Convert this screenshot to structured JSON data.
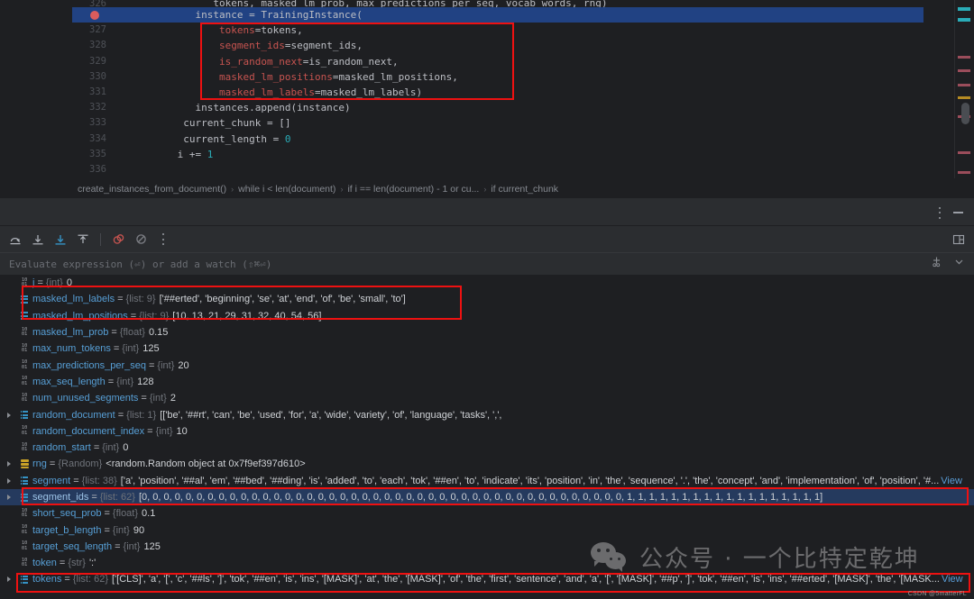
{
  "editor": {
    "lines": [
      {
        "num": "326",
        "indent": 0,
        "partial": true,
        "current": false,
        "breakpoint": false,
        "text": "tokens, masked_lm_prob, max_predictions_per_seq, vocab_words, rng)"
      },
      {
        "num": "",
        "indent": 0,
        "partial": false,
        "current": true,
        "breakpoint": true,
        "text": "instance = TrainingInstance("
      },
      {
        "num": "327",
        "indent": 0,
        "partial": false,
        "current": false,
        "breakpoint": false,
        "param": "tokens",
        "text": "=tokens,"
      },
      {
        "num": "328",
        "indent": 0,
        "partial": false,
        "current": false,
        "breakpoint": false,
        "param": "segment_ids",
        "text": "=segment_ids,"
      },
      {
        "num": "329",
        "indent": 0,
        "partial": false,
        "current": false,
        "breakpoint": false,
        "param": "is_random_next",
        "text": "=is_random_next,"
      },
      {
        "num": "330",
        "indent": 0,
        "partial": false,
        "current": false,
        "breakpoint": false,
        "param": "masked_lm_positions",
        "text": "=masked_lm_positions,"
      },
      {
        "num": "331",
        "indent": 0,
        "partial": false,
        "current": false,
        "breakpoint": false,
        "param": "masked_lm_labels",
        "text": "=masked_lm_labels)"
      },
      {
        "num": "332",
        "indent": 0,
        "partial": false,
        "current": false,
        "breakpoint": false,
        "text": "instances.append(instance)"
      },
      {
        "num": "333",
        "indent": 0,
        "partial": false,
        "current": false,
        "breakpoint": false,
        "text": "current_chunk = []"
      },
      {
        "num": "334",
        "indent": 0,
        "partial": false,
        "current": false,
        "breakpoint": false,
        "text": "current_length = ",
        "num_lit": "0"
      },
      {
        "num": "335",
        "indent": 0,
        "partial": false,
        "current": false,
        "breakpoint": false,
        "text": "i += ",
        "num_lit": "1"
      },
      {
        "num": "336",
        "indent": 0,
        "partial": false,
        "current": false,
        "breakpoint": false,
        "text": ""
      }
    ],
    "breadcrumb": [
      "create_instances_from_document()",
      "while i < len(document)",
      "if i == len(document) - 1 or cu...",
      "if current_chunk"
    ]
  },
  "debug_toolbar": {
    "buttons": [
      {
        "name": "step-over-icon",
        "title": "Step Over"
      },
      {
        "name": "step-into-icon",
        "title": "Step Into"
      },
      {
        "name": "force-step-into-icon",
        "title": "Force Step Into"
      },
      {
        "name": "step-out-icon",
        "title": "Step Out"
      },
      {
        "name": "mute-breakpoints-icon",
        "title": "Mute Breakpoints"
      },
      {
        "name": "no-breakpoint-icon",
        "title": "View Breakpoints"
      },
      {
        "name": "more-options-icon",
        "title": "More"
      }
    ],
    "layout_toggle": "layout-settings-icon"
  },
  "evaluate": {
    "placeholder": "Evaluate expression (⏎) or add a watch (⇧⌘⏎)",
    "add_watch_icon": "add-watch-icon",
    "expand_icon": "chevron-down-icon"
  },
  "panel_header": {
    "more_icon": "more-vertical-icon",
    "minimize_icon": "minimize-icon"
  },
  "variables": [
    {
      "expandable": false,
      "icon": "number",
      "name": "j",
      "type": "{int}",
      "value": "0",
      "selected": false,
      "view": false
    },
    {
      "expandable": false,
      "icon": "list",
      "name": "masked_lm_labels",
      "type": "{list: 9}",
      "value": "['##erted', 'beginning', 'se', 'at', 'end', 'of', 'be', 'small', 'to']",
      "selected": false,
      "view": false
    },
    {
      "expandable": false,
      "icon": "list",
      "name": "masked_lm_positions",
      "type": "{list: 9}",
      "value": "[10, 13, 21, 29, 31, 32, 40, 54, 56]",
      "selected": false,
      "view": false
    },
    {
      "expandable": false,
      "icon": "number",
      "name": "masked_lm_prob",
      "type": "{float}",
      "value": "0.15",
      "selected": false,
      "view": false
    },
    {
      "expandable": false,
      "icon": "number",
      "name": "max_num_tokens",
      "type": "{int}",
      "value": "125",
      "selected": false,
      "view": false
    },
    {
      "expandable": false,
      "icon": "number",
      "name": "max_predictions_per_seq",
      "type": "{int}",
      "value": "20",
      "selected": false,
      "view": false
    },
    {
      "expandable": false,
      "icon": "number",
      "name": "max_seq_length",
      "type": "{int}",
      "value": "128",
      "selected": false,
      "view": false
    },
    {
      "expandable": false,
      "icon": "number",
      "name": "num_unused_segments",
      "type": "{int}",
      "value": "2",
      "selected": false,
      "view": false
    },
    {
      "expandable": true,
      "icon": "list",
      "name": "random_document",
      "type": "{list: 1}",
      "value": "[['be', '##rt', 'can', 'be', 'used', 'for', 'a', 'wide', 'variety', 'of', 'language', 'tasks', ',',",
      "selected": false,
      "view": false
    },
    {
      "expandable": false,
      "icon": "number",
      "name": "random_document_index",
      "type": "{int}",
      "value": "10",
      "selected": false,
      "view": false
    },
    {
      "expandable": false,
      "icon": "number",
      "name": "random_start",
      "type": "{int}",
      "value": "0",
      "selected": false,
      "view": false
    },
    {
      "expandable": true,
      "icon": "object",
      "name": "rng",
      "type": "{Random}",
      "value": "<random.Random object at 0x7f9ef397d610>",
      "selected": false,
      "view": false
    },
    {
      "expandable": true,
      "icon": "list",
      "name": "segment",
      "type": "{list: 38}",
      "value": "['a', 'position', '##al', 'em', '##bed', '##ding', 'is', 'added', 'to', 'each', 'tok', '##en', 'to', 'indicate', 'its', 'position', 'in', 'the', 'sequence', '.', 'the', 'concept', 'and', 'implementation', 'of', 'position', '#...",
      "selected": false,
      "view": true
    },
    {
      "expandable": true,
      "icon": "list",
      "name": "segment_ids",
      "type": "{list: 62}",
      "value": "[0, 0, 0, 0, 0, 0, 0, 0, 0, 0, 0, 0, 0, 0, 0, 0, 0, 0, 0, 0, 0, 0, 0, 0, 0, 0, 0, 0, 0, 0, 0, 0, 0, 0, 0, 0, 0, 0, 0, 0, 0, 0, 0, 0, 1, 1, 1, 1, 1, 1, 1, 1, 1, 1, 1, 1, 1, 1, 1, 1, 1, 1]",
      "selected": true,
      "view": false
    },
    {
      "expandable": false,
      "icon": "number",
      "name": "short_seq_prob",
      "type": "{float}",
      "value": "0.1",
      "selected": false,
      "view": false
    },
    {
      "expandable": false,
      "icon": "number",
      "name": "target_b_length",
      "type": "{int}",
      "value": "90",
      "selected": false,
      "view": false
    },
    {
      "expandable": false,
      "icon": "number",
      "name": "target_seq_length",
      "type": "{int}",
      "value": "125",
      "selected": false,
      "view": false
    },
    {
      "expandable": false,
      "icon": "number",
      "name": "token",
      "type": "{str}",
      "value": "':'",
      "selected": false,
      "view": false
    },
    {
      "expandable": true,
      "icon": "list",
      "name": "tokens",
      "type": "{list: 62}",
      "value": "['[CLS]', 'a', '[', 'c', '##ls', ']', 'tok', '##en', 'is', 'ins', '[MASK]', 'at', 'the', '[MASK]', 'of', 'the', 'first', 'sentence', 'and', 'a', '[', '[MASK]', '##p', ']', 'tok', '##en', 'is', 'ins', '##erted', '[MASK]', 'the', '[MASK...",
      "selected": false,
      "view": true
    }
  ],
  "view_link_label": "View",
  "watermark": {
    "text": "公众号 · 一个比特定乾坤",
    "logo": "wechat-icon",
    "credit": "CSDN @5matterFL"
  },
  "colors": {
    "accent_selection": "#253a5e",
    "current_line": "#214283",
    "annotation_red": "#ee1111",
    "var_name": "#579fd6",
    "param_red": "#c75450",
    "number_cyan": "#2aacb8"
  }
}
